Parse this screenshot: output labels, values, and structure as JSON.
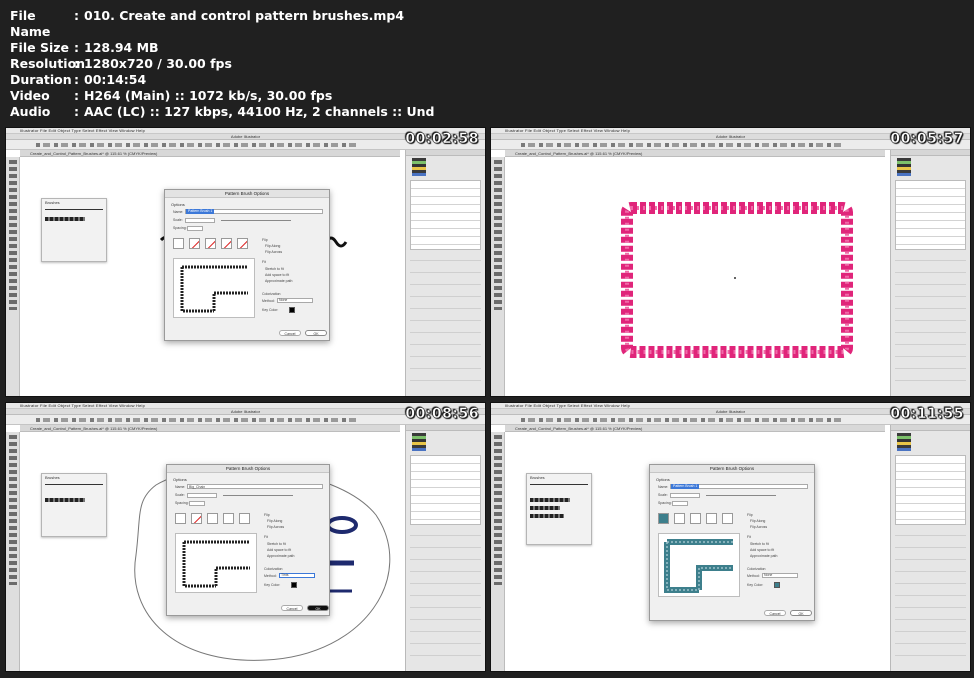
{
  "file_info": [
    {
      "key": "File Name",
      "value": "010. Create and control pattern brushes.mp4"
    },
    {
      "key": "File Size",
      "value": "128.94 MB"
    },
    {
      "key": "Resolution",
      "value": "1280x720 / 30.00 fps"
    },
    {
      "key": "Duration",
      "value": "00:14:54"
    },
    {
      "key": "Video",
      "value": "H264 (Main) :: 1072 kb/s, 30.00 fps"
    },
    {
      "key": "Audio",
      "value": "AAC (LC) :: 127 kbps, 44100 Hz, 2 channels :: Und"
    }
  ],
  "separator": ":",
  "app": {
    "menu": "Illustrator   File   Edit   Object   Type   Select   Effect   View   Window   Help",
    "title": "Adobe Illustrator",
    "doc_tab": "Create_and_Control_Pattern_Brushes.ai* @ 115.61 % (CMYK/Preview)",
    "brushes_panel_title": "Brushes"
  },
  "thumbnails": [
    {
      "timestamp": "00:02:58",
      "dialog_title": "Pattern Brush Options",
      "name_value": "Pattern Brush 1",
      "cancel": "Cancel",
      "ok": "OK"
    },
    {
      "timestamp": "00:05:57"
    },
    {
      "timestamp": "00:08:56",
      "dialog_title": "Pattern Brush Options",
      "name_value": "Big_Chain",
      "cancel": "Cancel",
      "ok": "OK"
    },
    {
      "timestamp": "00:11:55",
      "dialog_title": "Pattern Brush Options",
      "name_value": "Pattern Brush 1",
      "cancel": "Cancel",
      "ok": "OK"
    }
  ],
  "dialog_labels": {
    "options": "Options",
    "name": "Name:",
    "scale": "Scale:",
    "spacing": "Spacing:",
    "flip": "Flip",
    "flip_along": "Flip Along",
    "flip_across": "Flip Across",
    "fit": "Fit",
    "stretch": "Stretch to fit",
    "add_space": "Add space to fit",
    "approx": "Approximate path",
    "colorization": "Colorization",
    "method": "Method:",
    "method_none": "None",
    "method_tints": "Tints",
    "key_color": "Key Color:"
  },
  "colors": {
    "border_pink": "#e0257a",
    "teal": "#3d7f8c",
    "selection_blue": "#3c78d8",
    "navy": "#1e2a6e"
  }
}
